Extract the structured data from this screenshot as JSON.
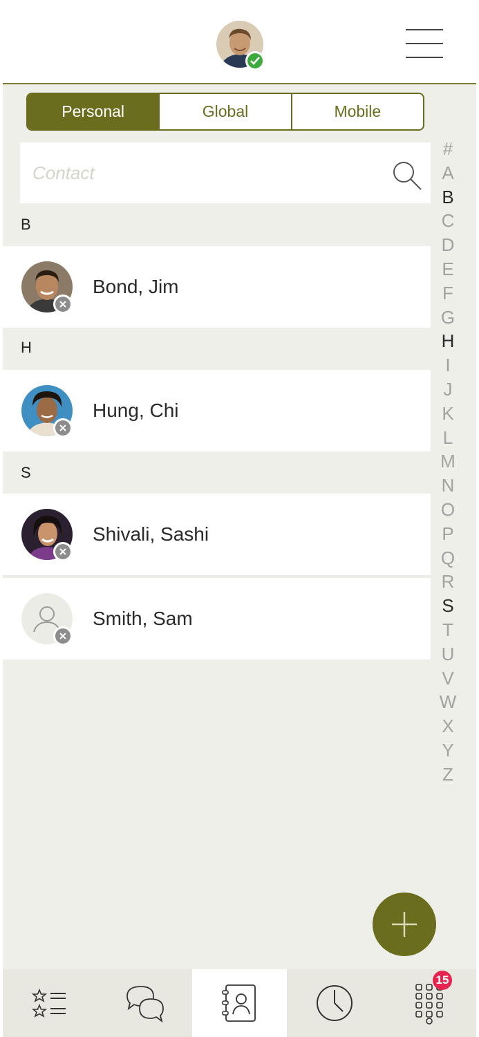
{
  "header": {
    "menu_icon": "hamburger-menu-icon",
    "me_presence": "available"
  },
  "tabs": [
    {
      "label": "Personal",
      "active": true
    },
    {
      "label": "Global",
      "active": false
    },
    {
      "label": "Mobile",
      "active": false
    }
  ],
  "search": {
    "placeholder": "Contact",
    "value": "",
    "icon": "search-icon"
  },
  "sections": [
    {
      "letter": "B",
      "contacts": [
        {
          "name": "Bond, Jim",
          "presence": "offline"
        }
      ]
    },
    {
      "letter": "H",
      "contacts": [
        {
          "name": "Hung, Chi",
          "presence": "offline"
        }
      ]
    },
    {
      "letter": "S",
      "contacts": [
        {
          "name": "Shivali, Sashi",
          "presence": "offline"
        },
        {
          "name": "Smith, Sam",
          "presence": "offline"
        }
      ]
    }
  ],
  "alpha_index": {
    "letters": [
      "#",
      "A",
      "B",
      "C",
      "D",
      "E",
      "F",
      "G",
      "H",
      "I",
      "J",
      "K",
      "L",
      "M",
      "N",
      "O",
      "P",
      "Q",
      "R",
      "S",
      "T",
      "U",
      "V",
      "W",
      "X",
      "Y",
      "Z"
    ],
    "highlighted": [
      "B",
      "H",
      "S"
    ]
  },
  "fab": {
    "icon": "plus-icon"
  },
  "bottom_nav": {
    "items": [
      {
        "name": "favorites",
        "icon": "favorites-list-icon",
        "active": false
      },
      {
        "name": "chat",
        "icon": "chat-bubbles-icon",
        "active": false
      },
      {
        "name": "contacts",
        "icon": "address-book-icon",
        "active": true
      },
      {
        "name": "history",
        "icon": "clock-icon",
        "active": false
      },
      {
        "name": "dialpad",
        "icon": "dialpad-icon",
        "active": false,
        "badge": "15"
      }
    ]
  },
  "colors": {
    "accent": "#6a6d1d",
    "badge": "#e5244f",
    "available": "#3daa3d",
    "offline": "#8c8c8c"
  }
}
